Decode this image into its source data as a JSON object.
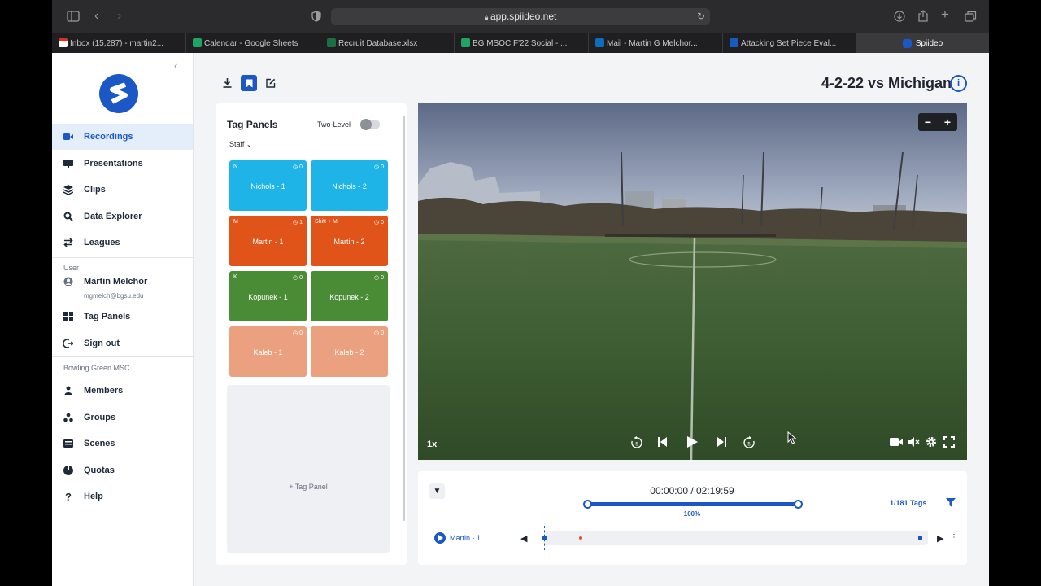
{
  "browser": {
    "url": "app.spiideo.net",
    "tabs": [
      {
        "title": "Inbox (15,287) - martin2...",
        "favicon_color": "#ffffff",
        "favicon_accent": "#d93025"
      },
      {
        "title": "Calendar - Google Sheets",
        "favicon_color": "#1fa463"
      },
      {
        "title": "Recruit Database.xlsx",
        "favicon_color": "#1d6f42"
      },
      {
        "title": "BG MSOC F'22 Social - ...",
        "favicon_color": "#1fa463"
      },
      {
        "title": "Mail - Martin G Melchor...",
        "favicon_color": "#0f6cbd"
      },
      {
        "title": "Attacking Set Piece Eval...",
        "favicon_color": "#185abd"
      },
      {
        "title": "Spiideo",
        "favicon_color": "#1c57c6",
        "active": true
      }
    ]
  },
  "sidebar": {
    "collapse_icon": "chevron-left-icon",
    "nav": [
      {
        "label": "Recordings",
        "icon": "video-camera-icon",
        "active": true
      },
      {
        "label": "Presentations",
        "icon": "monitor-icon"
      },
      {
        "label": "Clips",
        "icon": "layers-icon"
      },
      {
        "label": "Data Explorer",
        "icon": "magnifier-icon"
      },
      {
        "label": "Leagues",
        "icon": "swap-arrows-icon"
      }
    ],
    "user_section": "User",
    "user_name": "Martin Melchor",
    "user_email": "mgmelch@bgsu.edu",
    "user_nav": [
      {
        "label": "Tag Panels",
        "icon": "grid-icon"
      },
      {
        "label": "Sign out",
        "icon": "sign-out-icon"
      }
    ],
    "org_section": "Bowling Green MSC",
    "org_nav": [
      {
        "label": "Members",
        "icon": "person-icon"
      },
      {
        "label": "Groups",
        "icon": "group-icon"
      },
      {
        "label": "Scenes",
        "icon": "scenes-icon"
      },
      {
        "label": "Quotas",
        "icon": "pie-icon"
      },
      {
        "label": "Help",
        "icon": "question-icon"
      }
    ]
  },
  "main": {
    "title": "4-2-22 vs Michigan",
    "tools": [
      "download-icon",
      "bookmark-icon",
      "edit-icon"
    ]
  },
  "tag_panel": {
    "title": "Tag Panels",
    "two_level_label": "Two-Level",
    "two_level_on": false,
    "group": "Staff",
    "add_label": "+ Tag Panel",
    "tags": [
      {
        "name": "Nichols - 1",
        "hotkey": "N",
        "count": "0",
        "color": "#1fb4e8"
      },
      {
        "name": "Nichols - 2",
        "hotkey": "",
        "count": "0",
        "color": "#1fb4e8"
      },
      {
        "name": "Martin - 1",
        "hotkey": "M",
        "count": "1",
        "color": "#e0541a"
      },
      {
        "name": "Martin - 2",
        "hotkey": "Shift + M",
        "count": "0",
        "color": "#e0541a"
      },
      {
        "name": "Kopunek - 1",
        "hotkey": "K",
        "count": "0",
        "color": "#4a8b35"
      },
      {
        "name": "Kopunek - 2",
        "hotkey": "",
        "count": "0",
        "color": "#4a8b35"
      },
      {
        "name": "Kaleb - 1",
        "hotkey": "",
        "count": "0",
        "color": "#eba07f"
      },
      {
        "name": "Kaleb - 2",
        "hotkey": "",
        "count": "0",
        "color": "#eba07f"
      }
    ]
  },
  "player": {
    "speed": "1x",
    "zoom_out": "−",
    "zoom_in": "+"
  },
  "timeline": {
    "time": "00:00:00 / 02:19:59",
    "zoom_percent": "100%",
    "tags_count": "1/181 Tags",
    "active_tag": "Martin - 1",
    "playhead_fraction": 0,
    "accent": "#1c57c6"
  }
}
